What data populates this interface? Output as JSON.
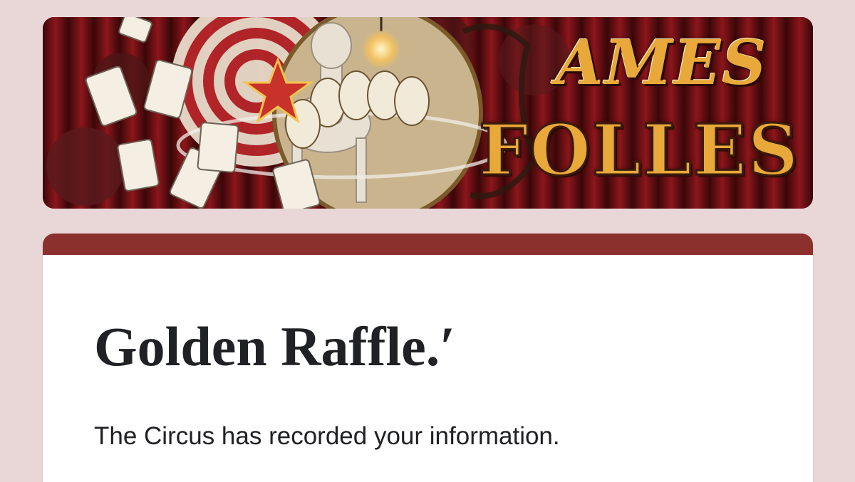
{
  "banner": {
    "logo_line1": "AMES",
    "logo_line2": "FOLLES",
    "colors": {
      "curtain": "#7a1418",
      "logo_gold": "#e8a93a"
    }
  },
  "form": {
    "accent_color": "#8b302d",
    "title": "Golden Raffle.′",
    "confirmation_message": "The Circus has recorded your information."
  },
  "theme": {
    "page_background": "#e9d7d8",
    "card_background": "#ffffff"
  }
}
